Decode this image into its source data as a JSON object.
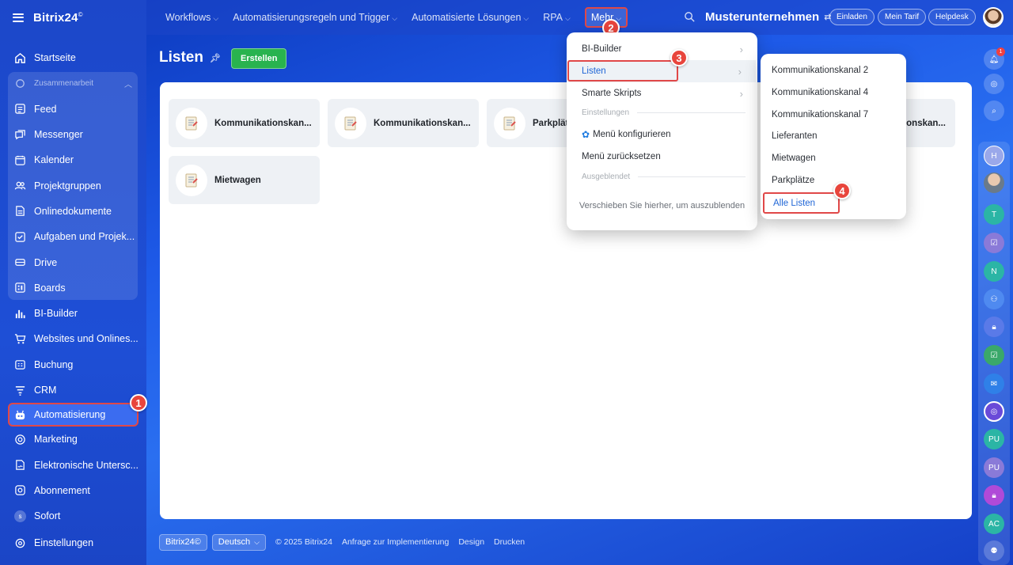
{
  "brand": {
    "name": "Bitrix24",
    "mark": "©"
  },
  "sidebar": {
    "items": [
      {
        "label": "Startseite",
        "icon": "home-icon"
      },
      {
        "label": "Zusammenarbeit",
        "icon": "collab-icon"
      },
      {
        "label": "Feed",
        "icon": "feed-icon"
      },
      {
        "label": "Messenger",
        "icon": "chat-icon"
      },
      {
        "label": "Kalender",
        "icon": "calendar-icon"
      },
      {
        "label": "Projektgruppen",
        "icon": "group-icon"
      },
      {
        "label": "Onlinedokumente",
        "icon": "doc-icon"
      },
      {
        "label": "Aufgaben und Projek...",
        "icon": "task-icon"
      },
      {
        "label": "Drive",
        "icon": "drive-icon"
      },
      {
        "label": "Boards",
        "icon": "board-icon"
      },
      {
        "label": "BI-Builder",
        "icon": "chart-icon"
      },
      {
        "label": "Websites und Onlines...",
        "icon": "cart-icon"
      },
      {
        "label": "Buchung",
        "icon": "booking-icon"
      },
      {
        "label": "CRM",
        "icon": "funnel-icon"
      },
      {
        "label": "Automatisierung",
        "icon": "robot-icon"
      },
      {
        "label": "Marketing",
        "icon": "marketing-icon"
      },
      {
        "label": "Elektronische Untersc...",
        "icon": "signature-icon"
      },
      {
        "label": "Abonnement",
        "icon": "subscription-icon"
      },
      {
        "label": "Sofort",
        "icon": "s-badge-icon",
        "badge": "s"
      },
      {
        "label": "Einstellungen",
        "icon": "gear-icon"
      }
    ]
  },
  "topbar": {
    "nav": [
      "Workflows",
      "Automatisierungsregeln und Trigger",
      "Automatisierte Lösungen",
      "RPA",
      "Mehr"
    ],
    "company": "Musterunternehmen",
    "buttons": [
      "Einladen",
      "Mein Tarif",
      "Helpdesk"
    ]
  },
  "page": {
    "title": "Listen",
    "create_label": "Erstellen"
  },
  "cards": [
    {
      "title": "Kommunikationskan..."
    },
    {
      "title": "Kommunikationskan..."
    },
    {
      "title": "Parkplätze"
    },
    {
      "title": "...onskan..."
    },
    {
      "title": "Mietwagen"
    }
  ],
  "dropdown": {
    "items": [
      "BI-Builder",
      "Listen",
      "Smarte Skripts"
    ],
    "settings_header": "Einstellungen",
    "configure": "Menü konfigurieren",
    "reset": "Menü zurücksetzen",
    "hidden_header": "Ausgeblendet",
    "hint": "Verschieben Sie hierher, um auszublenden"
  },
  "submenu": {
    "items": [
      "Kommunikationskanal 2",
      "Kommunikationskanal 4",
      "Kommunikationskanal 7",
      "Lieferanten",
      "Mietwagen",
      "Parkplätze"
    ],
    "all": "Alle Listen"
  },
  "markers": [
    "1",
    "2",
    "3",
    "4"
  ],
  "footer": {
    "brand": "Bitrix24©",
    "language": "Deutsch",
    "copyright": "© 2025 Bitrix24",
    "links": [
      "Anfrage zur Implementierung",
      "Design",
      "Drucken"
    ]
  },
  "rightbar": {
    "notification_count": "1",
    "initials": [
      "H",
      "T",
      "N",
      "PU",
      "PU",
      "AC"
    ]
  },
  "colors": {
    "accent_green": "#29b34f",
    "highlight_red": "#e04848",
    "link_blue": "#2066d6"
  }
}
